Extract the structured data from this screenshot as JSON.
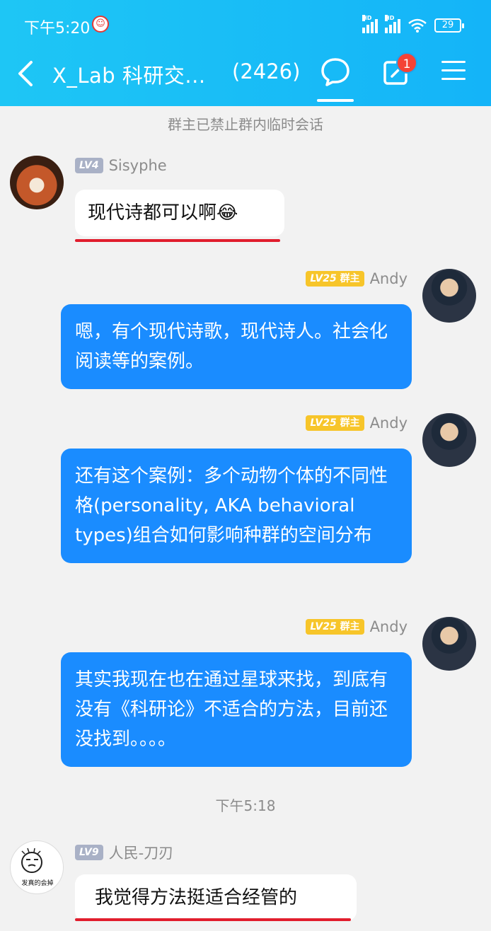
{
  "status": {
    "time": "下午5:20",
    "battery": "29"
  },
  "header": {
    "title": "X_Lab 科研交...",
    "member_count": "(2426)",
    "notif_count": "1"
  },
  "system_notice": "群主已禁止群内临时会话",
  "messages": [
    {
      "sender": "Sisyphe",
      "level": "LV4",
      "text": "现代诗都可以啊😂"
    },
    {
      "sender": "Andy",
      "level": "LV25",
      "role": "群主",
      "text": "嗯，有个现代诗歌，现代诗人。社会化阅读等的案例。"
    },
    {
      "sender": "Andy",
      "level": "LV25",
      "role": "群主",
      "text": "还有这个案例：多个动物个体的不同性格(personality, AKA behavioral types)组合如何影响种群的空间分布"
    },
    {
      "sender": "Andy",
      "level": "LV25",
      "role": "群主",
      "text": "其实我现在也在通过星球来找，到底有没有《科研论》不适合的方法，目前还没找到。。。。"
    },
    {
      "timestamp": "下午5:18"
    },
    {
      "sender": "人民-刀刃",
      "level": "LV9",
      "text": "我觉得方法挺适合经管的",
      "avatar_caption": "发真的会掉"
    }
  ],
  "colors": {
    "header": "#14b4f8",
    "bubble_right": "#1a8cff",
    "highlight": "#e11d2d",
    "owner_badge": "#f7c52a"
  }
}
